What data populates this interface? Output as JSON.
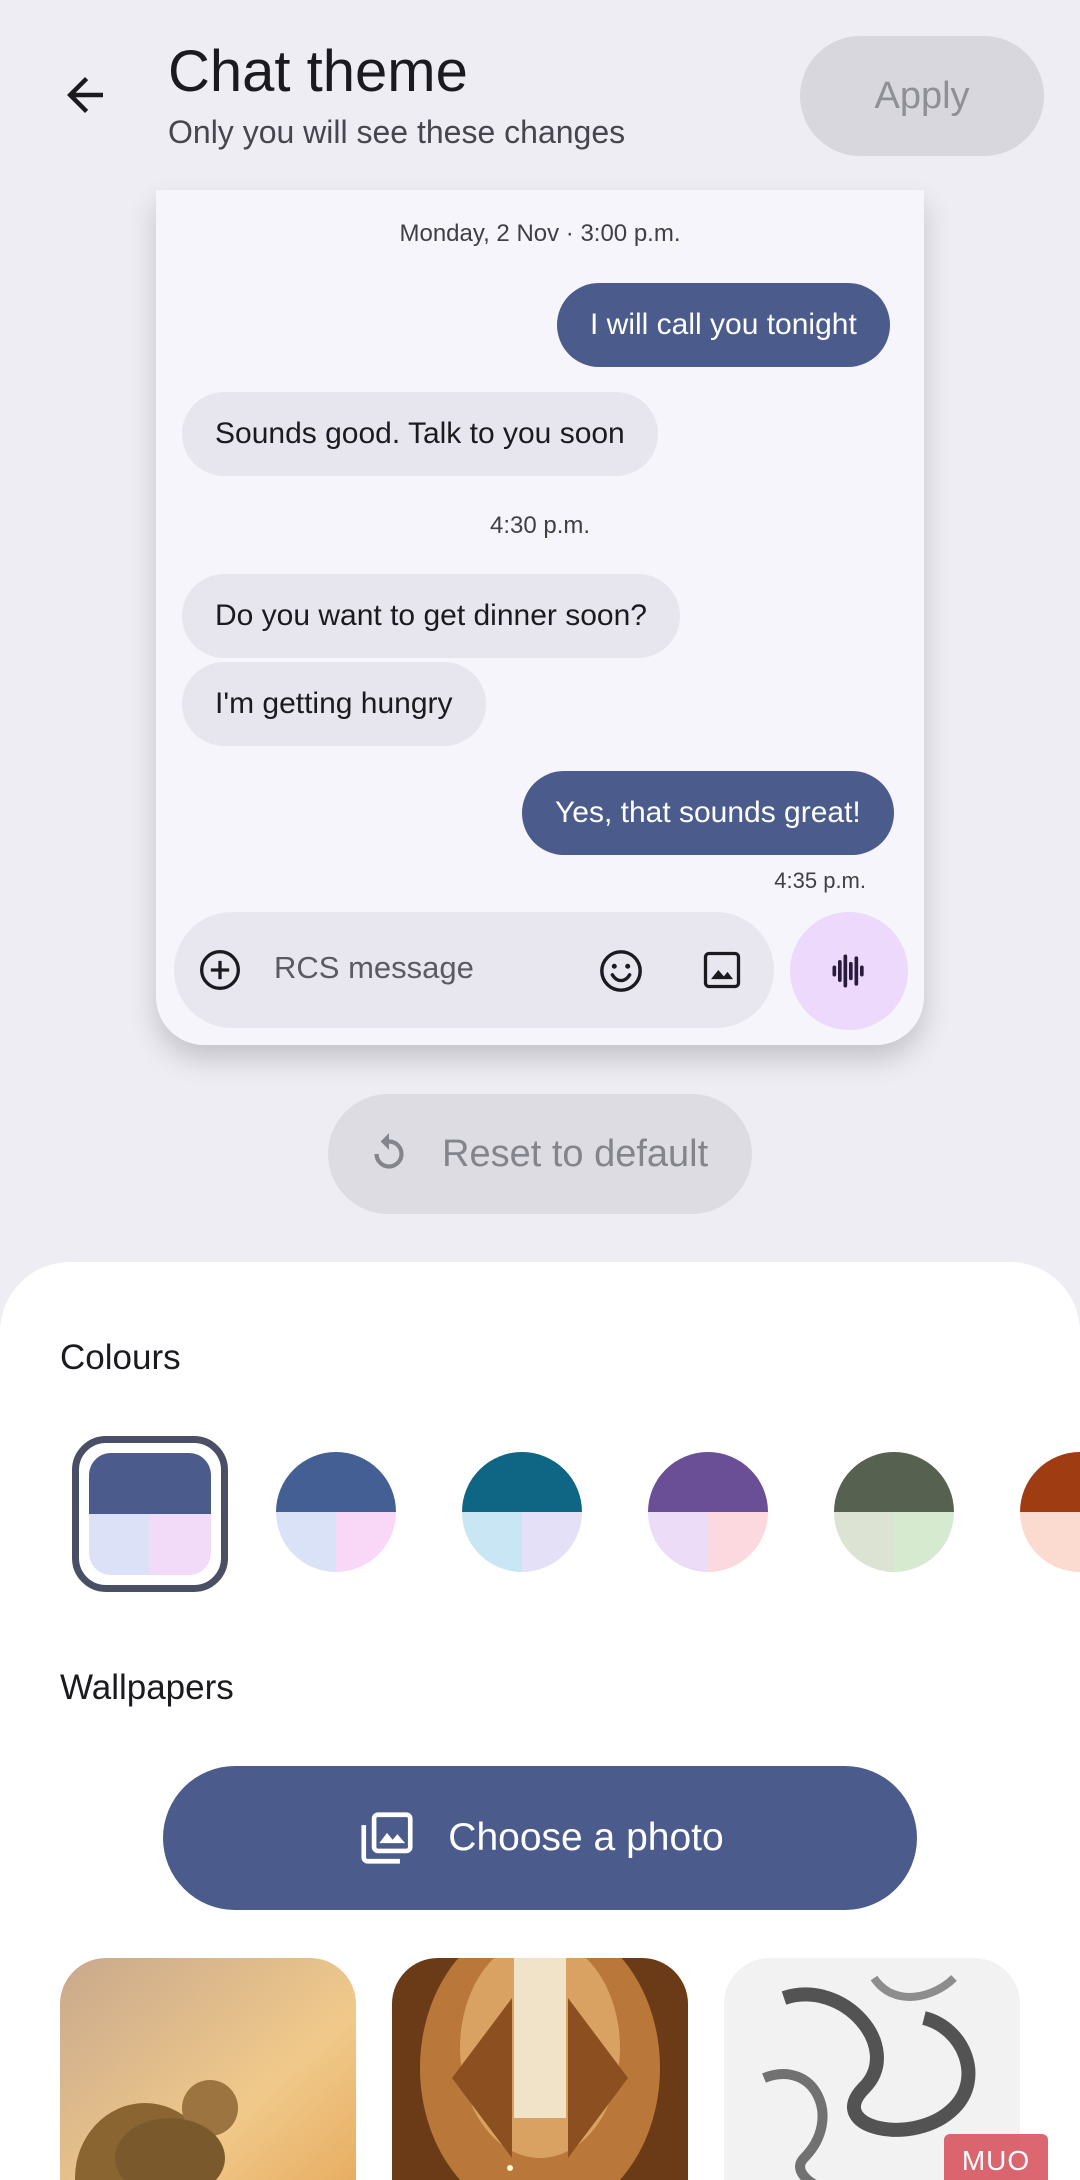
{
  "header": {
    "title": "Chat theme",
    "subtitle": "Only you will see these changes",
    "apply_label": "Apply"
  },
  "preview": {
    "timestamp1": "Monday, 2 Nov · 3:00 p.m.",
    "timestamp2": "4:30 p.m.",
    "timestamp3": "4:35 p.m.",
    "messages": [
      {
        "text": "I will call you tonight",
        "direction": "outgoing"
      },
      {
        "text": "Sounds good. Talk to you soon",
        "direction": "incoming"
      },
      {
        "text": "Do you want to get dinner soon?",
        "direction": "incoming"
      },
      {
        "text": "I'm getting hungry",
        "direction": "incoming"
      },
      {
        "text": "Yes, that sounds great!",
        "direction": "outgoing"
      }
    ],
    "compose_placeholder": "RCS message"
  },
  "reset_label": "Reset to default",
  "colours": {
    "label": "Colours",
    "swatches": [
      {
        "top": "#4b5b8b",
        "bottom_left": "#dde1f7",
        "bottom_right": "#f2dbf9",
        "selected": true
      },
      {
        "top": "#445f93",
        "bottom_left": "#d9e2f7",
        "bottom_right": "#f9d8f7",
        "selected": false
      },
      {
        "top": "#0f6684",
        "bottom_left": "#c8e6f4",
        "bottom_right": "#e3e0f7",
        "selected": false
      },
      {
        "top": "#6a4f96",
        "bottom_left": "#ecdcf7",
        "bottom_right": "#fbd9de",
        "selected": false
      },
      {
        "top": "#57614f",
        "bottom_left": "#dde3d2",
        "bottom_right": "#d6ead0",
        "selected": false
      },
      {
        "top": "#a03c12",
        "bottom_left": "#fbdad0",
        "bottom_right": "#fbdad0",
        "selected": false
      }
    ]
  },
  "wallpapers": {
    "label": "Wallpapers",
    "choose_label": "Choose a photo",
    "items": [
      "monkey-photo",
      "staircase-photo",
      "ink-smoke-photo"
    ]
  },
  "watermark": "MUO"
}
